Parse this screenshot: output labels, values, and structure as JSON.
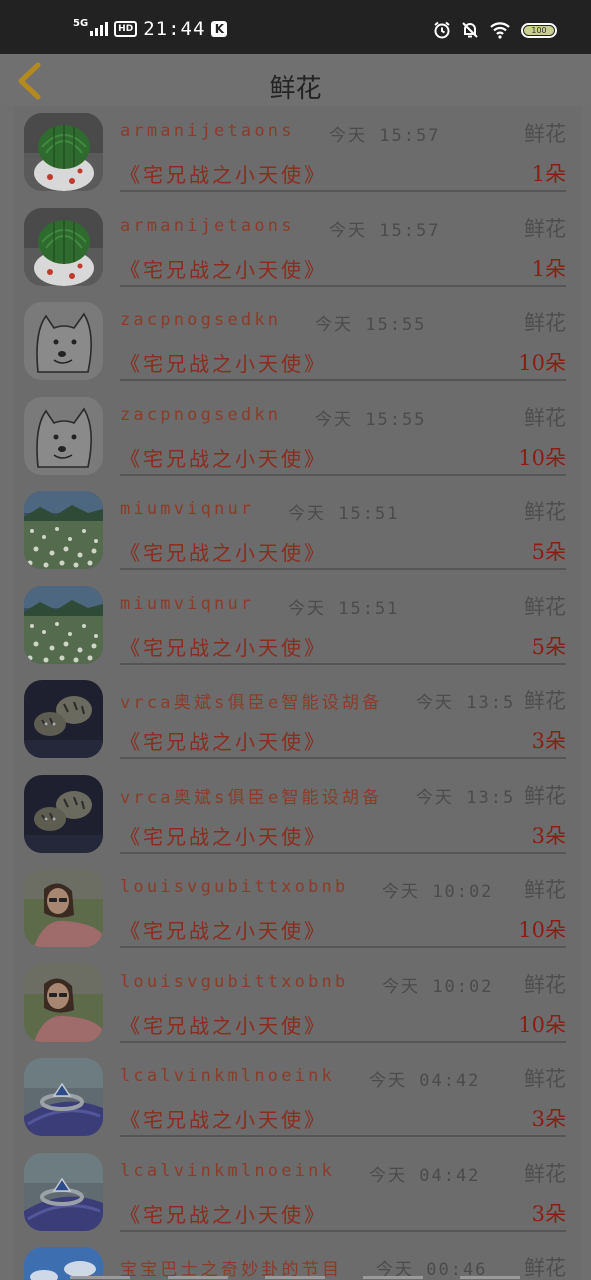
{
  "status_bar": {
    "network": "5G",
    "hd": "HD",
    "time": "21:44",
    "k_badge": "K",
    "battery": "100",
    "battery_level": 1.0,
    "icons": [
      "alarm-icon",
      "bell-off-icon",
      "wifi-icon",
      "battery-icon"
    ]
  },
  "header": {
    "back_icon": "chevron-left-icon",
    "title": "鲜花"
  },
  "colors": {
    "name": "#8b3c29",
    "book": "#8b2c1e",
    "qty": "#8b1d12",
    "back_arrow": "#b48a1f"
  },
  "records": [
    {
      "avatar": "cactus",
      "user": "armanijetaons",
      "time": "今天 15:57",
      "gift": "鲜花",
      "book": "《宅兄战之小天使》",
      "qty": "1朵"
    },
    {
      "avatar": "cactus",
      "user": "armanijetaons",
      "time": "今天 15:57",
      "gift": "鲜花",
      "book": "《宅兄战之小天使》",
      "qty": "1朵"
    },
    {
      "avatar": "doge",
      "user": "zacpnogsedkn",
      "time": "今天 15:55",
      "gift": "鲜花",
      "book": "《宅兄战之小天使》",
      "qty": "10朵"
    },
    {
      "avatar": "doge",
      "user": "zacpnogsedkn",
      "time": "今天 15:55",
      "gift": "鲜花",
      "book": "《宅兄战之小天使》",
      "qty": "10朵"
    },
    {
      "avatar": "meadow",
      "user": "miumviqnur",
      "time": "今天 15:51",
      "gift": "鲜花",
      "book": "《宅兄战之小天使》",
      "qty": "5朵"
    },
    {
      "avatar": "meadow",
      "user": "miumviqnur",
      "time": "今天 15:51",
      "gift": "鲜花",
      "book": "《宅兄战之小天使》",
      "qty": "5朵"
    },
    {
      "avatar": "tigers",
      "user": "vrca奥斌s俱臣e智能设胡备",
      "time": "今天 13:5",
      "gift": "鲜花",
      "book": "《宅兄战之小天使》",
      "qty": "3朵"
    },
    {
      "avatar": "tigers",
      "user": "vrca奥斌s俱臣e智能设胡备",
      "time": "今天 13:5",
      "gift": "鲜花",
      "book": "《宅兄战之小天使》",
      "qty": "3朵"
    },
    {
      "avatar": "girl",
      "user": "louisvgubittxobnb",
      "time": "今天 10:02",
      "gift": "鲜花",
      "book": "《宅兄战之小天使》",
      "qty": "10朵"
    },
    {
      "avatar": "girl",
      "user": "louisvgubittxobnb",
      "time": "今天 10:02",
      "gift": "鲜花",
      "book": "《宅兄战之小天使》",
      "qty": "10朵"
    },
    {
      "avatar": "ring",
      "user": "lcalvinkmlnoeink",
      "time": "今天 04:42",
      "gift": "鲜花",
      "book": "《宅兄战之小天使》",
      "qty": "3朵"
    },
    {
      "avatar": "ring",
      "user": "lcalvinkmlnoeink",
      "time": "今天 04:42",
      "gift": "鲜花",
      "book": "《宅兄战之小天使》",
      "qty": "3朵"
    },
    {
      "avatar": "sky",
      "user": "宝宝巴士之奇妙卦的节目",
      "time": "今天 00:46",
      "gift": "鲜花",
      "book": "",
      "qty": ""
    }
  ]
}
